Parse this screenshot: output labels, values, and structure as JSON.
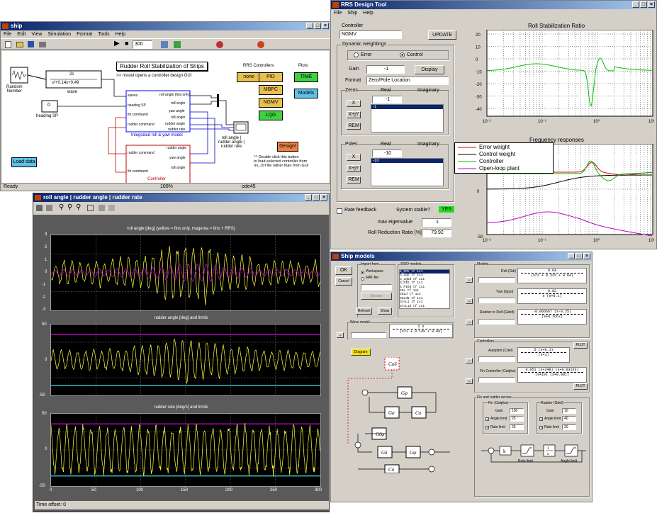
{
  "simulink": {
    "title": "ship",
    "menu": [
      "File",
      "Edit",
      "View",
      "Simulation",
      "Format",
      "Tools",
      "Help"
    ],
    "stop_time": "300",
    "status_left": "Ready",
    "status_mid": "100%",
    "status_right": "ode45",
    "diagram_title": "Rudder Roll Stabilization of Ships",
    "note1": ">> rrstool opens a controller design GUI",
    "random_label": "Random\nNumber",
    "tf_num": "2s",
    "tf_den": "s²+0.14s+0.49",
    "wave": "wave",
    "const_val": "0",
    "heading_sp": "heading SP",
    "model_in": [
      "waves",
      "heading SP",
      "fin command",
      "rudder command"
    ],
    "model_out": [
      "roll angle (fins only)",
      "roll angle",
      "yaw angle",
      "roll angle",
      "rudder angle",
      "rudder rate"
    ],
    "model_name": "Integrated roll & yaw model",
    "ctrl_in": [
      "rudder command",
      "fin command"
    ],
    "ctrl_out": [
      "rudder angle",
      "yaw angle",
      "roll angle"
    ],
    "ctrl_name": "Controller",
    "scope_label": "roll angle |\nrudder angle |\nrudder rate",
    "rrs_controllers": "RRS Controllers",
    "plots": "Plots",
    "ctl_buttons": [
      "none",
      "PID",
      "MBPC",
      "NGMV",
      "LQG"
    ],
    "plot_buttons": [
      "TIME",
      "Models"
    ],
    "design": "Design!",
    "note2": "^^ Double-click this button\nto load selected controller from\nrrs_ctrl file rather than from GUI",
    "load_data": "Load data"
  },
  "scopewin": {
    "title": "roll angle | rudder angle | rudder rate",
    "plot1_title": "roll angle [deg] (yellow = fins only, magenta = fins + RRS)",
    "plot1_y": [
      "3",
      "2",
      "1",
      "0",
      "-1",
      "-2",
      "-3"
    ],
    "plot2_title": "rudder angle [deg] and limits",
    "plot2_y": [
      "50",
      "0",
      "-50"
    ],
    "plot3_title": "rudder rate [deg/s] and limits",
    "plot3_y": [
      "50",
      "0",
      "-50"
    ],
    "x_ticks": [
      "0",
      "50",
      "100",
      "150",
      "200",
      "250",
      "300"
    ],
    "time_offset": "Time offset:  0"
  },
  "rrs": {
    "title": "RRS Design Tool",
    "menu": [
      "File",
      "Ship",
      "Help"
    ],
    "controller_label": "Controller",
    "controller": "NGMV",
    "update": "UPDATE",
    "dyn_weight": "Dynamic weightings",
    "radio_error": "Error",
    "radio_control": "Control",
    "gain_label": "Gain",
    "gain": "-1",
    "display": "Display",
    "format_label": "Format",
    "format": "Zero/Pole Location",
    "zeros": "Zeros",
    "real": "Real",
    "imaginary": "Imaginary",
    "zero_real": "-1",
    "zero_list": "-1",
    "poles": "Poles",
    "pole_real": "-10",
    "pole_list": "-10",
    "x": "X",
    "xjy": "X+jY",
    "rem": "REM",
    "rate_feedback": "Rate feedback",
    "stable_label": "System stable?",
    "stable": "YES",
    "max_eig_label": "max eigenvalue",
    "max_eig": "1",
    "rrr_label": "Roll Reduction Ratio [%]",
    "rrr": "79.92",
    "chart1_title": "Roll Stabilization Ratio",
    "chart1_y": [
      "20",
      "10",
      "0",
      "-10",
      "-20",
      "-30",
      "-40"
    ],
    "chart1_x": [
      "10⁻²",
      "10⁻¹",
      "10⁰",
      "10¹"
    ],
    "chart2_title": "Frequency responses",
    "chart2_y": [
      "50",
      "0",
      "-50"
    ],
    "chart2_x": [
      "10⁻²",
      "10⁻¹",
      "10⁰",
      "10¹"
    ],
    "legend": [
      "Error weight",
      "Control weight",
      "Controller",
      "Open-loop plant"
    ],
    "legend_colors": [
      "#e00000",
      "#000000",
      "#00c000",
      "#c000c0"
    ]
  },
  "models": {
    "title": "Ship models",
    "ok": "OK",
    "cancel": "Cancel",
    "import_from": "Import from",
    "workspace": "Workspace",
    "matfile": "MAT-file",
    "browse": "Browse",
    "refresh": "Refresh",
    "show": "Show",
    "siso": "SISO models",
    "siso_list": [
      "G_GMV  tf 1x1",
      "G_LQG  tf 1x1",
      "G_LQGd tf 1x1",
      "G_PID  tf 1x1",
      "G_PIDd tf 1x1",
      "GGL    tf 1x1",
      "GGLd   tf 1x1",
      "GGLdN  tf 1x1",
      "GroL1  tf 1x1",
      "GroL1d tf 1x1"
    ],
    "wave_model": "Wave model",
    "wave_num": "2 s",
    "wave_den": "(s^2 + 0.14s + 0.49)",
    "diagram": "Diagram",
    "models_label": "Models",
    "roll_label": "Roll (Gdi)",
    "roll_num": "0.64",
    "roll_den": "(s^2 + 0.32s + 0.64)",
    "yaw_label": "Yaw (Gpsi)",
    "yaw_num": "0.02",
    "yaw_den": "s (s+0.1)",
    "r2r_label": "Rudder to Roll (Gdelt)",
    "r2r_num": "-0.066667 (s-0.25)",
    "r2r_den": "(s+0.1667)",
    "controllers": "Controllers",
    "autopilot_label": "Autopilot (Cdel)",
    "autopilot_num": "5 (s+0.1)",
    "autopilot_den": "(s+1)",
    "fin_label": "Fin Controller (Calpha)",
    "fin_num": "0.051 (s+248) (s+0.03163)",
    "fin_den": "(s+10) (s+0.001)",
    "plot": "PLOT",
    "servos": "Fin and rudder servos",
    "fin_servo": "Fin (Galpha)",
    "rudder_servo": "Rudder (Gdel)",
    "gain_lbl": "Gain",
    "fin_gain": "100",
    "rud_gain": "10",
    "angle_limit": "Angle limit",
    "rate_limit": "Rate limit",
    "fin_angle": "25",
    "fin_rate": "25",
    "rud_angle": "40",
    "rud_rate": "20",
    "rate_limit_lbl": "Rate limit",
    "angle_limit_lbl": "Angle limit"
  }
}
